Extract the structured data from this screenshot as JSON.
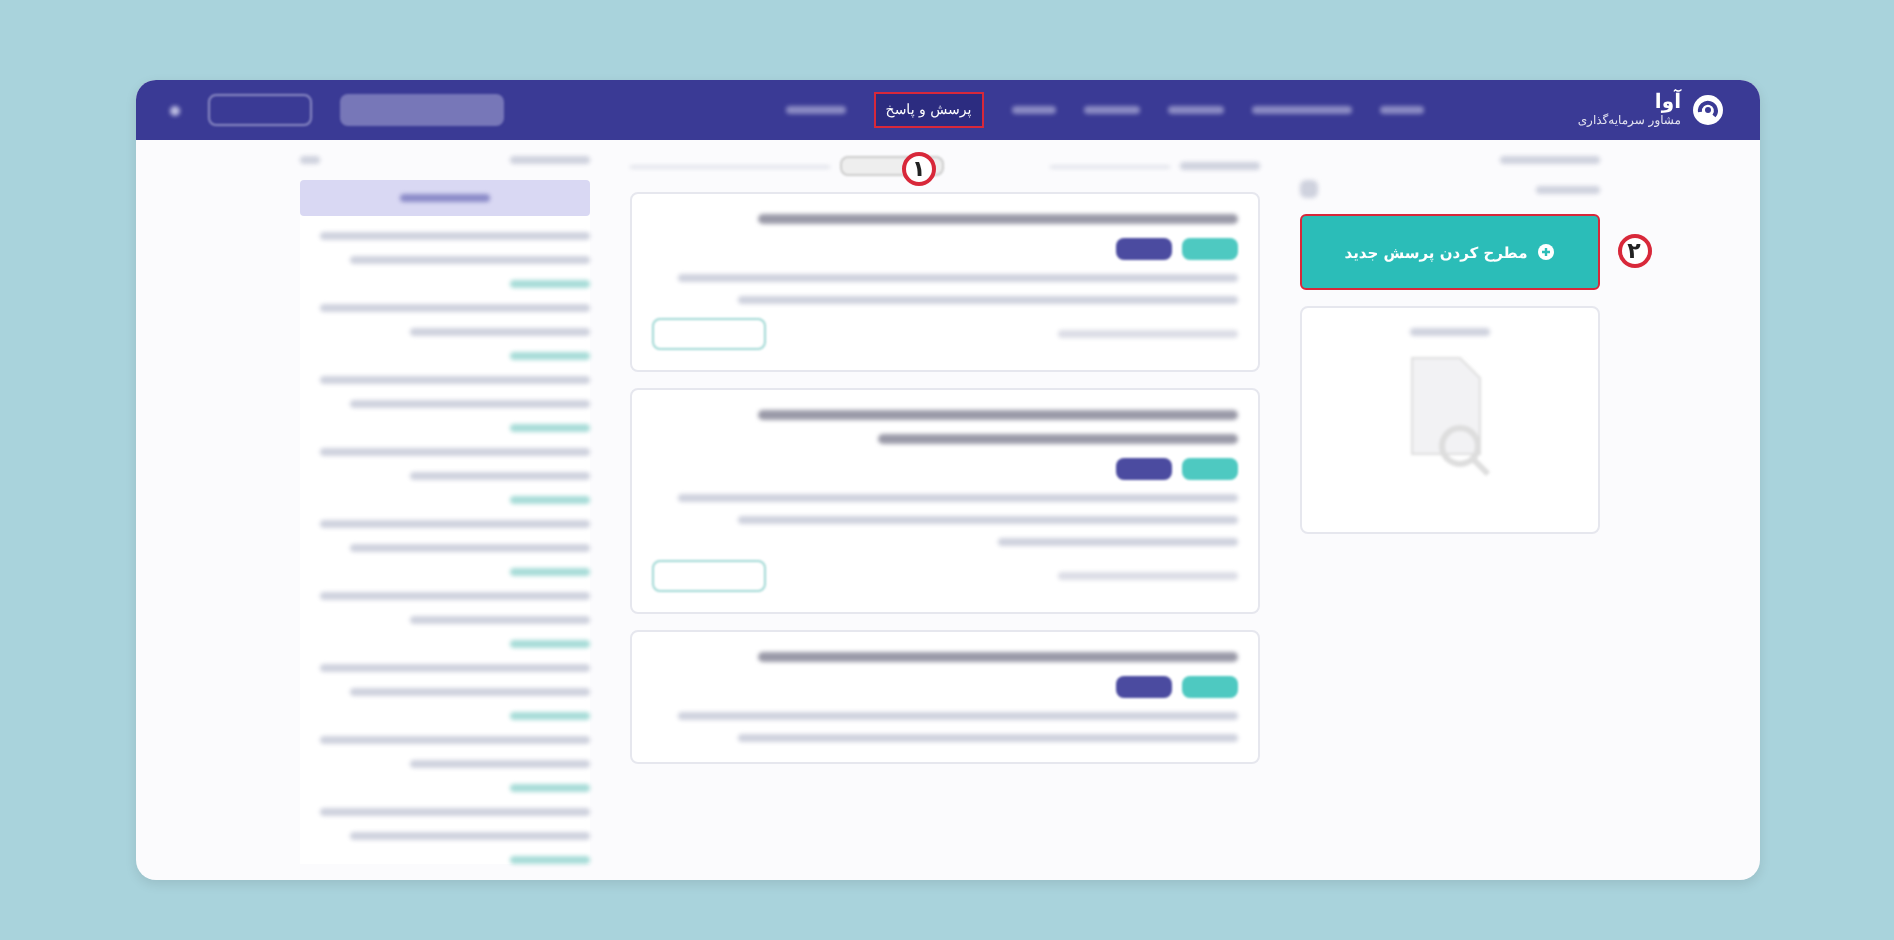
{
  "brand": {
    "name": "آوا",
    "tagline": "مشاور سرمایه‌گذاری"
  },
  "nav": [
    {
      "label": "پرسش و پاسخ",
      "selected": true,
      "annotation": "۱"
    }
  ],
  "new_question_button": {
    "label": "مطرح کردن پرسش جدید",
    "annotation": "۲"
  }
}
